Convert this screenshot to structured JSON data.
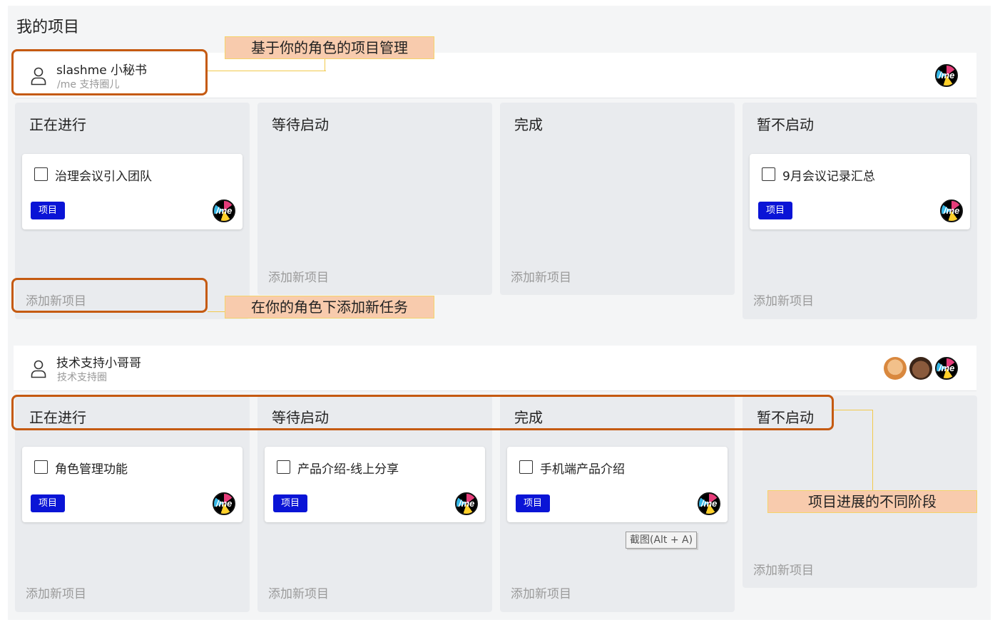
{
  "page": {
    "title": "我的项目"
  },
  "groups": [
    {
      "role_name": "slashme 小秘书",
      "role_circle": "/me 支持圈儿",
      "avatars": [
        "me-avatar"
      ],
      "columns": [
        {
          "title": "正在进行",
          "add_label": "添加新项目",
          "cards": [
            {
              "title": "治理会议引入团队",
              "tag": "项目"
            }
          ]
        },
        {
          "title": "等待启动",
          "add_label": "添加新项目",
          "cards": []
        },
        {
          "title": "完成",
          "add_label": "添加新项目",
          "cards": []
        },
        {
          "title": "暂不启动",
          "add_label": "添加新项目",
          "cards": [
            {
              "title": "9月会议记录汇总",
              "tag": "项目"
            }
          ]
        }
      ]
    },
    {
      "role_name": "技术支持小哥哥",
      "role_circle": "技术支持圈",
      "avatars": [
        "avatar-1",
        "avatar-2",
        "me-avatar"
      ],
      "columns": [
        {
          "title": "正在进行",
          "add_label": "添加新项目",
          "cards": [
            {
              "title": "角色管理功能",
              "tag": "项目"
            }
          ]
        },
        {
          "title": "等待启动",
          "add_label": "添加新项目",
          "cards": [
            {
              "title": "产品介绍-线上分享",
              "tag": "项目"
            }
          ]
        },
        {
          "title": "完成",
          "add_label": "添加新项目",
          "cards": [
            {
              "title": "手机端产品介绍",
              "tag": "项目"
            }
          ]
        },
        {
          "title": "暂不启动",
          "add_label": "添加新项目",
          "cards": []
        }
      ]
    }
  ],
  "annotations": {
    "role_based": "基于你的角色的项目管理",
    "add_task": "在你的角色下添加新任务",
    "stages": "项目进展的不同阶段"
  },
  "tooltip": "截图(Alt + A)",
  "colors": {
    "tag_blue": "#0a14d6",
    "annotation_orange": "#c55a11",
    "callout_fill": "#f8cbad"
  }
}
